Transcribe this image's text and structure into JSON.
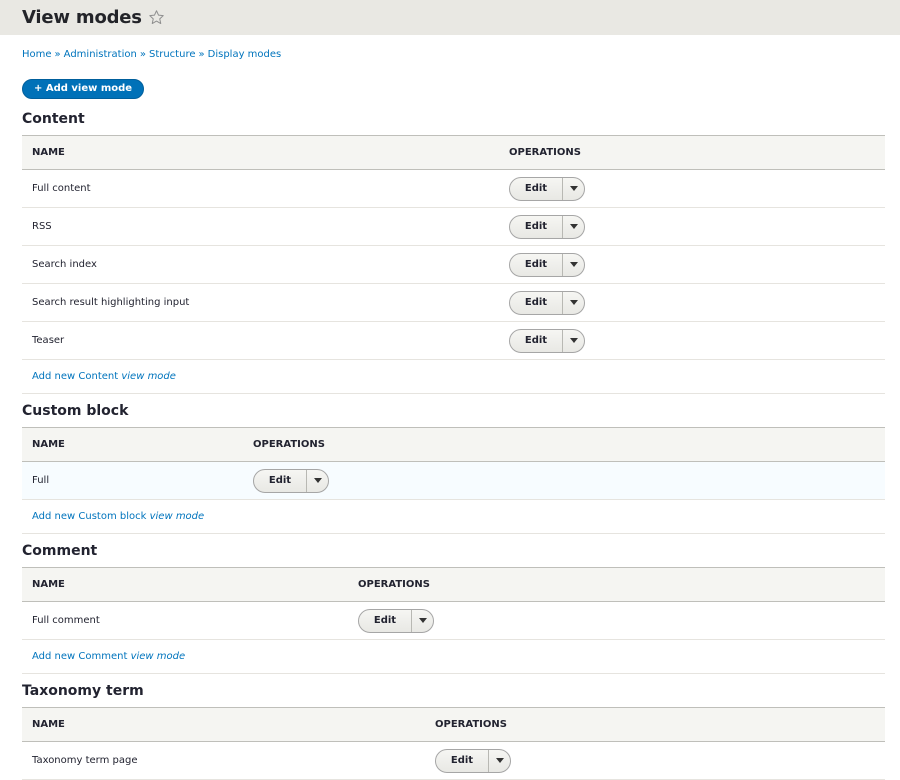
{
  "header": {
    "title": "View modes",
    "star_icon": "star-outline-icon"
  },
  "breadcrumb": [
    {
      "label": "Home"
    },
    {
      "label": "Administration"
    },
    {
      "label": "Structure"
    },
    {
      "label": "Display modes"
    }
  ],
  "breadcrumb_separator": "»",
  "add_button": {
    "label": "+ Add view mode"
  },
  "columns": {
    "name": "NAME",
    "operations": "OPERATIONS"
  },
  "edit_label": "Edit",
  "view_mode_label": "view mode",
  "sections": [
    {
      "title": "Content",
      "rows": [
        "Full content",
        "RSS",
        "Search index",
        "Search result highlighting input",
        "Teaser"
      ],
      "add_link": "Add new Content"
    },
    {
      "title": "Custom block",
      "rows": [
        "Full"
      ],
      "add_link": "Add new Custom block"
    },
    {
      "title": "Comment",
      "rows": [
        "Full comment"
      ],
      "add_link": "Add new Comment"
    },
    {
      "title": "Taxonomy term",
      "rows": [
        "Taxonomy term page"
      ],
      "add_link": ""
    }
  ],
  "colors": {
    "link": "#0074bd",
    "primary_button": "#0071b8",
    "header_bg": "#e9e8e3"
  }
}
